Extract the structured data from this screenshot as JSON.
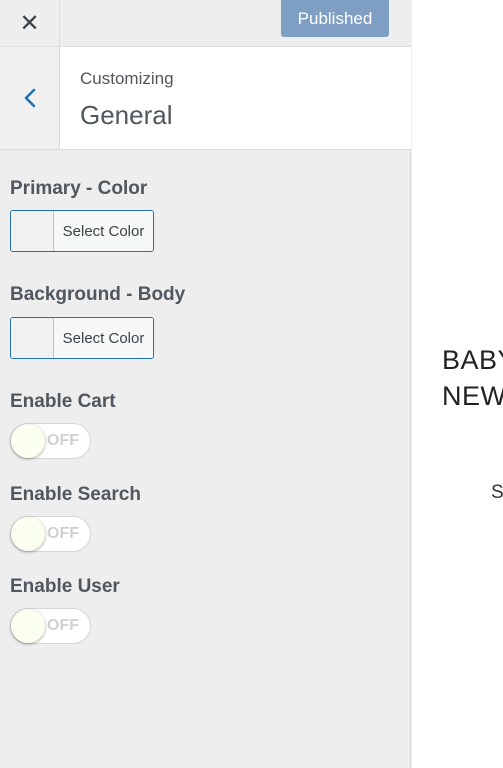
{
  "topbar": {
    "close_glyph": "✕",
    "publish_label": "Published"
  },
  "section": {
    "breadcrumb": "Customizing",
    "title": "General"
  },
  "controls": {
    "primary_color": {
      "label": "Primary - Color",
      "button": "Select Color"
    },
    "background_body": {
      "label": "Background - Body",
      "button": "Select Color"
    },
    "enable_cart": {
      "label": "Enable Cart",
      "state": "OFF"
    },
    "enable_search": {
      "label": "Enable Search",
      "state": "OFF"
    },
    "enable_user": {
      "label": "Enable User",
      "state": "OFF"
    }
  },
  "preview": {
    "line1": "BABY",
    "line2": "NEW",
    "small": "S"
  },
  "colors": {
    "accent": "#2271b1",
    "publish_bg": "#7e9ec3",
    "panel_bg": "#eeeeee"
  },
  "icons": {
    "close": "close-icon",
    "back": "chevron-left-icon"
  }
}
